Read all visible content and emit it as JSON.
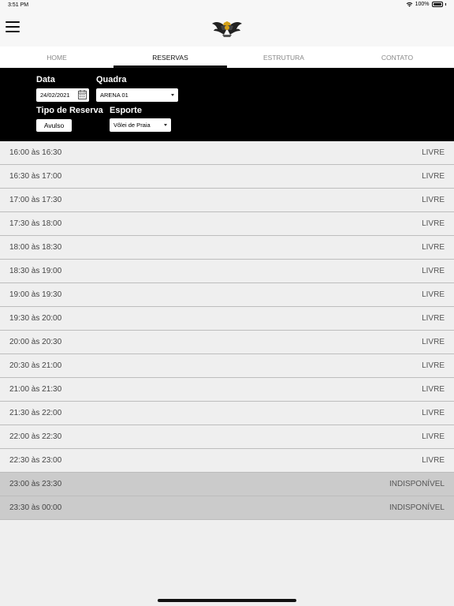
{
  "status_bar": {
    "time": "3:51 PM",
    "battery": "100%"
  },
  "tabs": [
    {
      "label": "HOME"
    },
    {
      "label": "RESERVAS"
    },
    {
      "label": "ESTRUTURA"
    },
    {
      "label": "CONTATO"
    }
  ],
  "filters": {
    "date_label": "Data",
    "date_value": "24/02/2021",
    "court_label": "Quadra",
    "court_value": "ARENA 01",
    "type_label": "Tipo de Reserva",
    "type_value": "Avulso",
    "sport_label": "Esporte",
    "sport_value": "Vôlei de Praia"
  },
  "slots": [
    {
      "time": "16:00 às 16:30",
      "status": "LIVRE",
      "available": true
    },
    {
      "time": "16:30 às 17:00",
      "status": "LIVRE",
      "available": true
    },
    {
      "time": "17:00 às 17:30",
      "status": "LIVRE",
      "available": true
    },
    {
      "time": "17:30 às 18:00",
      "status": "LIVRE",
      "available": true
    },
    {
      "time": "18:00 às 18:30",
      "status": "LIVRE",
      "available": true
    },
    {
      "time": "18:30 às 19:00",
      "status": "LIVRE",
      "available": true
    },
    {
      "time": "19:00 às 19:30",
      "status": "LIVRE",
      "available": true
    },
    {
      "time": "19:30 às 20:00",
      "status": "LIVRE",
      "available": true
    },
    {
      "time": "20:00 às 20:30",
      "status": "LIVRE",
      "available": true
    },
    {
      "time": "20:30 às 21:00",
      "status": "LIVRE",
      "available": true
    },
    {
      "time": "21:00 às 21:30",
      "status": "LIVRE",
      "available": true
    },
    {
      "time": "21:30 às 22:00",
      "status": "LIVRE",
      "available": true
    },
    {
      "time": "22:00 às 22:30",
      "status": "LIVRE",
      "available": true
    },
    {
      "time": "22:30 às 23:00",
      "status": "LIVRE",
      "available": true
    },
    {
      "time": "23:00 às 23:30",
      "status": "INDISPONÍVEL",
      "available": false
    },
    {
      "time": "23:30 às 00:00",
      "status": "INDISPONÍVEL",
      "available": false
    }
  ]
}
